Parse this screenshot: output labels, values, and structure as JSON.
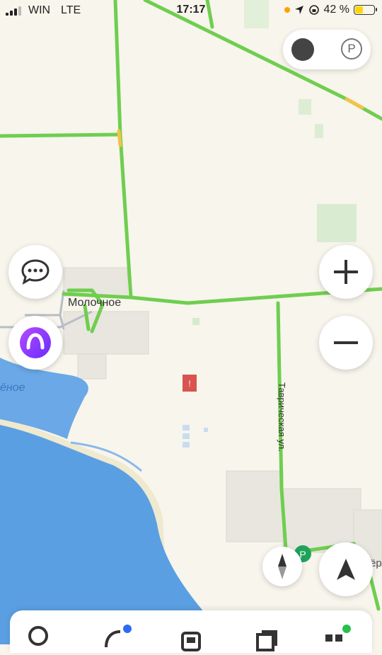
{
  "status_bar": {
    "carrier": "WIN",
    "network": "LTE",
    "time": "17:17",
    "battery_text": "42 %",
    "battery_level": 0.42
  },
  "map": {
    "town_label": "Молочное",
    "water_label": "ёное",
    "street_label": "Таврическая ул.",
    "edge_label": "озёр",
    "pin_label": "!",
    "parking_label": "P",
    "road_color": "#6fce4f",
    "water_color": "#5b9fe3",
    "land_color": "#f7f5ec"
  },
  "controls": {
    "zoom_in": "+",
    "zoom_out": "−",
    "traffic_toggle_icon": "traffic-light-icon",
    "parking_icon": "parking-icon",
    "chat_icon": "chat-bubble-icon",
    "alice_icon": "voice-assistant-icon",
    "compass_icon": "compass-icon",
    "location_icon": "location-arrow-icon"
  },
  "bottom_bar": {
    "tabs": [
      {
        "icon": "search-icon"
      },
      {
        "icon": "navigator-icon"
      },
      {
        "icon": "transport-icon"
      },
      {
        "icon": "bookmarks-icon"
      },
      {
        "icon": "services-icon"
      }
    ]
  }
}
